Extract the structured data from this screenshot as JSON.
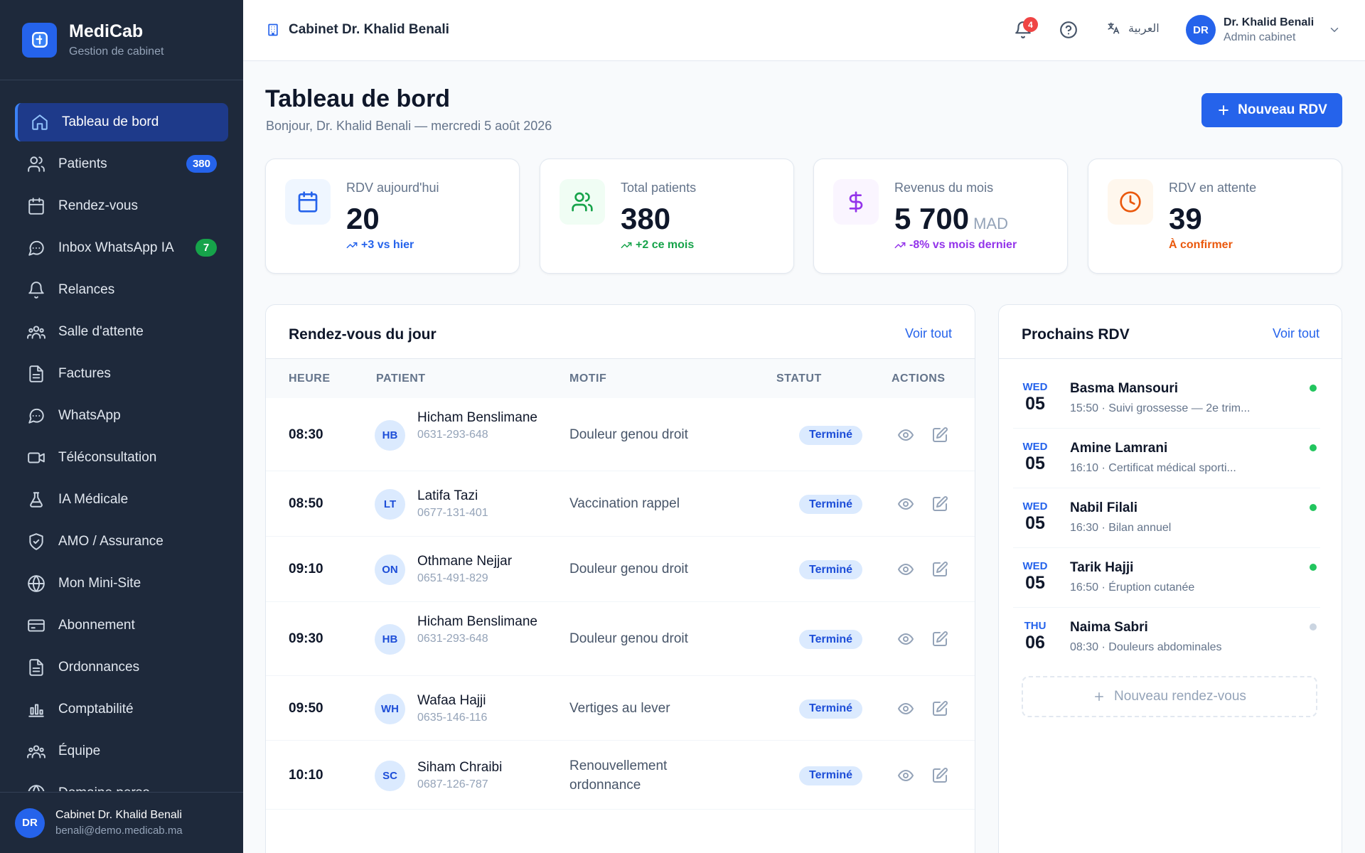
{
  "brand": {
    "name": "MediCab",
    "subtitle": "Gestion de cabinet"
  },
  "sidebar": {
    "items": [
      {
        "label": "Tableau de bord",
        "icon": "home-icon",
        "active": true
      },
      {
        "label": "Patients",
        "icon": "users-icon",
        "badge": "380"
      },
      {
        "label": "Rendez-vous",
        "icon": "calendar-icon"
      },
      {
        "label": "Inbox WhatsApp IA",
        "icon": "chat-icon",
        "badge": "7"
      },
      {
        "label": "Relances",
        "icon": "bell-icon"
      },
      {
        "label": "Salle d'attente",
        "icon": "group-icon"
      },
      {
        "label": "Factures",
        "icon": "file-icon"
      },
      {
        "label": "WhatsApp",
        "icon": "chat-icon"
      },
      {
        "label": "Téléconsultation",
        "icon": "video-icon"
      },
      {
        "label": "IA Médicale",
        "icon": "flask-icon"
      },
      {
        "label": "AMO / Assurance",
        "icon": "shield-icon"
      },
      {
        "label": "Mon Mini-Site",
        "icon": "globe-icon"
      },
      {
        "label": "Abonnement",
        "icon": "card-icon"
      },
      {
        "label": "Ordonnances",
        "icon": "file-icon"
      },
      {
        "label": "Comptabilité",
        "icon": "chart-icon"
      },
      {
        "label": "Équipe",
        "icon": "group-icon"
      },
      {
        "label": "Domaine perso",
        "icon": "globe-icon"
      }
    ],
    "footer": {
      "initials": "DR",
      "name": "Cabinet Dr. Khalid Benali",
      "email": "benali@demo.medicab.ma"
    }
  },
  "topbar": {
    "cabinet": "Cabinet Dr. Khalid Benali",
    "notifications": "4",
    "language": "العربية",
    "user": {
      "initials": "DR",
      "name": "Dr. Khalid Benali",
      "role": "Admin cabinet"
    }
  },
  "header": {
    "title": "Tableau de bord",
    "subtitle": "Bonjour, Dr. Khalid Benali — mercredi 5 août 2026",
    "new_button": "Nouveau RDV"
  },
  "stats": [
    {
      "label": "RDV aujourd'hui",
      "value": "20",
      "unit": "",
      "trend": "+3 vs hier",
      "color": "#2563eb",
      "bg": "#eff6ff"
    },
    {
      "label": "Total patients",
      "value": "380",
      "unit": "",
      "trend": "+2 ce mois",
      "color": "#16a34a",
      "bg": "#f0fdf4"
    },
    {
      "label": "Revenus du mois",
      "value": "5 700",
      "unit": "MAD",
      "trend": "-8% vs mois dernier",
      "color": "#9333ea",
      "bg": "#faf5ff"
    },
    {
      "label": "RDV en attente",
      "value": "39",
      "unit": "",
      "trend": "À confirmer",
      "color": "#ea580c",
      "bg": "#fff7ed"
    }
  ],
  "today": {
    "title": "Rendez-vous du jour",
    "link": "Voir tout",
    "columns": [
      "HEURE",
      "PATIENT",
      "MOTIF",
      "STATUT",
      "ACTIONS"
    ],
    "rows": [
      {
        "time": "08:30",
        "initials": "HB",
        "name": "Hicham Benslimane",
        "phone": "0631-293-648",
        "motif": "Douleur genou droit",
        "status": "Terminé"
      },
      {
        "time": "08:50",
        "initials": "LT",
        "name": "Latifa Tazi",
        "phone": "0677-131-401",
        "motif": "Vaccination rappel",
        "status": "Terminé"
      },
      {
        "time": "09:10",
        "initials": "ON",
        "name": "Othmane Nejjar",
        "phone": "0651-491-829",
        "motif": "Douleur genou droit",
        "status": "Terminé"
      },
      {
        "time": "09:30",
        "initials": "HB",
        "name": "Hicham Benslimane",
        "phone": "0631-293-648",
        "motif": "Douleur genou droit",
        "status": "Terminé"
      },
      {
        "time": "09:50",
        "initials": "WH",
        "name": "Wafaa Hajji",
        "phone": "0635-146-116",
        "motif": "Vertiges au lever",
        "status": "Terminé"
      },
      {
        "time": "10:10",
        "initials": "SC",
        "name": "Siham Chraibi",
        "phone": "0687-126-787",
        "motif": "Renouvellement ordonnance",
        "status": "Terminé"
      }
    ]
  },
  "upcoming": {
    "title": "Prochains RDV",
    "link": "Voir tout",
    "items": [
      {
        "day": "WED",
        "date": "05",
        "name": "Basma Mansouri",
        "meta": "15:50 · Suivi grossesse — 2e trim...",
        "dot": "#22c55e"
      },
      {
        "day": "WED",
        "date": "05",
        "name": "Amine Lamrani",
        "meta": "16:10 · Certificat médical sporti...",
        "dot": "#22c55e"
      },
      {
        "day": "WED",
        "date": "05",
        "name": "Nabil Filali",
        "meta": "16:30 · Bilan annuel",
        "dot": "#22c55e"
      },
      {
        "day": "WED",
        "date": "05",
        "name": "Tarik Hajji",
        "meta": "16:50 · Éruption cutanée",
        "dot": "#22c55e"
      },
      {
        "day": "THU",
        "date": "06",
        "name": "Naima Sabri",
        "meta": "08:30 · Douleurs abdominales",
        "dot": "#cbd5e1"
      }
    ],
    "new_button": "Nouveau rendez-vous"
  }
}
